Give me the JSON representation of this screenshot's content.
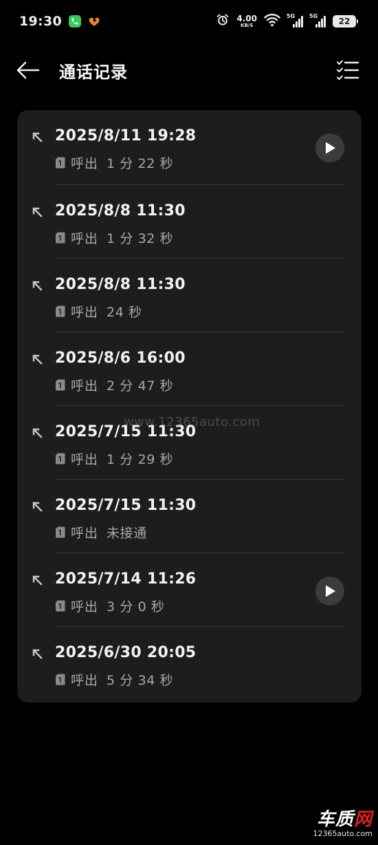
{
  "status_bar": {
    "time": "19:30",
    "net_speed": "4.00",
    "net_speed_unit": "KB/S",
    "signal_1_tag": "5G",
    "signal_2_tag": "5G",
    "battery": "22",
    "icons": [
      "phone-app-icon",
      "health-app-icon",
      "alarm-icon",
      "wifi-icon",
      "signal-icon",
      "battery-icon"
    ]
  },
  "header": {
    "title": "通话记录",
    "back_icon": "arrow-left-icon",
    "select_icon": "multi-select-icon"
  },
  "records": [
    {
      "datetime": "2025/8/11 19:28",
      "direction": "呼出",
      "duration": "1 分 22 秒",
      "has_recording": true
    },
    {
      "datetime": "2025/8/8 11:30",
      "direction": "呼出",
      "duration": "1 分 32 秒",
      "has_recording": false
    },
    {
      "datetime": "2025/8/8 11:30",
      "direction": "呼出",
      "duration": "24 秒",
      "has_recording": false
    },
    {
      "datetime": "2025/8/6 16:00",
      "direction": "呼出",
      "duration": "2 分 47 秒",
      "has_recording": false
    },
    {
      "datetime": "2025/7/15 11:30",
      "direction": "呼出",
      "duration": "1 分 29 秒",
      "has_recording": false
    },
    {
      "datetime": "2025/7/15 11:30",
      "direction": "呼出",
      "duration": "未接通",
      "has_recording": false
    },
    {
      "datetime": "2025/7/14 11:26",
      "direction": "呼出",
      "duration": "3 分 0 秒",
      "has_recording": true
    },
    {
      "datetime": "2025/6/30 20:05",
      "direction": "呼出",
      "duration": "5 分 34 秒",
      "has_recording": false
    }
  ],
  "watermark": {
    "center_text": "www.12365auto.com",
    "logo_text_white": "车质",
    "logo_text_red": "网",
    "logo_url": "12365auto.com"
  },
  "colors": {
    "background": "#000000",
    "card": "#1d1d1f",
    "primary_text": "#f2f2f2",
    "secondary_text": "#a9a9ab",
    "play_button": "#3c3c3e",
    "phone_badge": "#3cc85a",
    "health_badge": "#f08a24",
    "logo_accent": "#e02020"
  }
}
